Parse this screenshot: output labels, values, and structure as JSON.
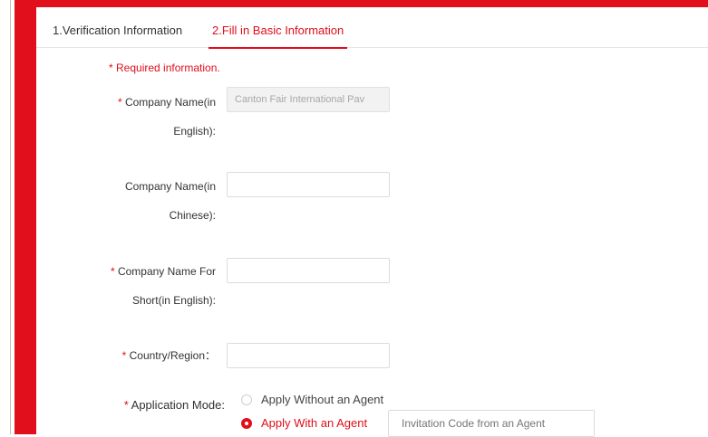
{
  "tabs": [
    {
      "label": "1.Verification Information"
    },
    {
      "label": "2.Fill in Basic Information"
    }
  ],
  "form": {
    "required_note": "* Required information.",
    "company_name_en": {
      "star": "*",
      "label_line1": "Company Name(in",
      "label_line2": "English):",
      "value": "Canton Fair International Pav"
    },
    "company_name_cn": {
      "label_line1": "Company Name(in",
      "label_line2": "Chinese):",
      "value": ""
    },
    "company_short": {
      "star": "*",
      "label_line1": "Company Name For",
      "label_line2": "Short(in English):",
      "value": ""
    },
    "country": {
      "star": "*",
      "label": "Country/Region：",
      "value": ""
    },
    "application_mode": {
      "star": "*",
      "label": "Application Mode:",
      "options": [
        {
          "label": "Apply Without an Agent",
          "selected": false
        },
        {
          "label": "Apply With an Agent",
          "selected": true
        }
      ],
      "agent_code_placeholder": "Invitation Code from an Agent"
    }
  },
  "colors": {
    "accent": "#e10e1c"
  }
}
